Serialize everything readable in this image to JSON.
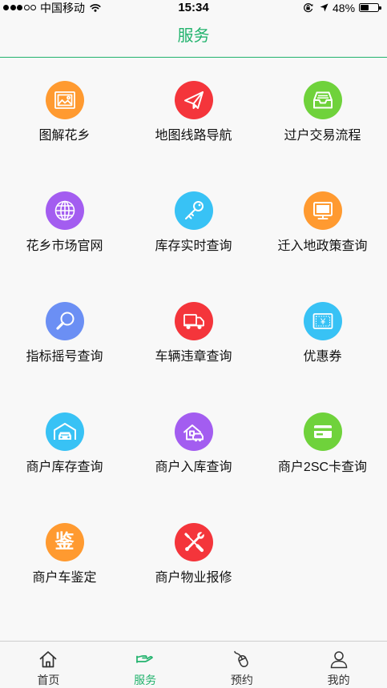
{
  "status_bar": {
    "signal": {
      "level": 3,
      "max": 5
    },
    "carrier": "中国移动",
    "time": "15:34",
    "battery_text": "48%",
    "battery_level": 48,
    "icons": [
      "wifi-icon",
      "rotation-lock-icon",
      "location-arrow-icon",
      "battery-icon"
    ]
  },
  "header": {
    "title": "服务"
  },
  "theme": {
    "accent": "#22b36d",
    "text": "#111111",
    "tab_inactive": "#333333"
  },
  "services": [
    {
      "label": "图解花乡",
      "icon": "picture-icon",
      "color": "#ff9a30"
    },
    {
      "label": "地图线路导航",
      "icon": "paper-plane-icon",
      "color": "#f4353b"
    },
    {
      "label": "过户交易流程",
      "icon": "inbox-tray-icon",
      "color": "#6fd23b"
    },
    {
      "label": "花乡市场官网",
      "icon": "globe-icon",
      "color": "#a35df0"
    },
    {
      "label": "库存实时查询",
      "icon": "key-icon",
      "color": "#38c2f5"
    },
    {
      "label": "迁入地政策查询",
      "icon": "monitor-icon",
      "color": "#ff9a30"
    },
    {
      "label": "指标摇号查询",
      "icon": "magnifier-icon",
      "color": "#6b8ff4"
    },
    {
      "label": "车辆违章查询",
      "icon": "truck-icon",
      "color": "#f4353b"
    },
    {
      "label": "优惠券",
      "icon": "ticket-icon",
      "color": "#38c2f5",
      "glyph": "¥"
    },
    {
      "label": "商户库存查询",
      "icon": "garage-car-icon",
      "color": "#38c2f5"
    },
    {
      "label": "商户入库查询",
      "icon": "house-car-icon",
      "color": "#a35df0"
    },
    {
      "label": "商户2SC卡查询",
      "icon": "card-icon",
      "color": "#6fd23b"
    },
    {
      "label": "商户车鉴定",
      "icon": "appraisal-icon",
      "color": "#ff9a30",
      "glyph": "鉴"
    },
    {
      "label": "商户物业报修",
      "icon": "tools-icon",
      "color": "#f4353b"
    }
  ],
  "tab_bar": {
    "items": [
      {
        "label": "首页",
        "icon": "home-icon",
        "active": false
      },
      {
        "label": "服务",
        "icon": "service-icon",
        "active": true
      },
      {
        "label": "预约",
        "icon": "mouse-icon",
        "active": false
      },
      {
        "label": "我的",
        "icon": "person-icon",
        "active": false
      }
    ]
  }
}
